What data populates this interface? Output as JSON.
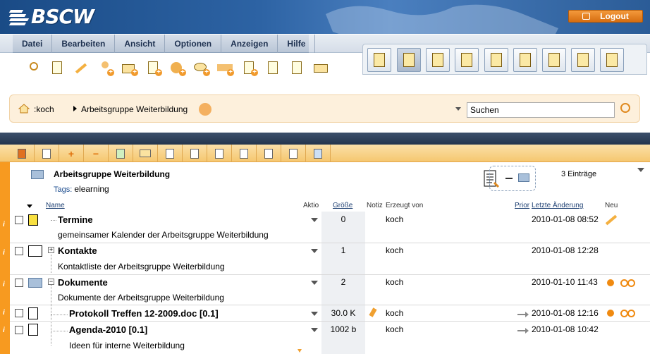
{
  "header": {
    "logo": "BSCW",
    "logout": "Logout"
  },
  "menu": [
    "Datei",
    "Bearbeiten",
    "Ansicht",
    "Optionen",
    "Anzeigen",
    "Hilfe"
  ],
  "toolbar_icons": [
    "search-icon",
    "info-icon",
    "edit-icon",
    "add-member-icon",
    "add-folder-icon",
    "add-document-icon",
    "add-url-icon",
    "add-discussion-icon",
    "add-appointment-icon",
    "add-task-icon",
    "send-icon",
    "copy-icon",
    "card-icon"
  ],
  "nav_buttons": [
    "clipboard-view-icon",
    "home-icon",
    "shared-folders-icon",
    "clipboard-icon",
    "bag-icon",
    "bookmark-icon",
    "calendar-icon",
    "tasks-icon",
    "trash-icon"
  ],
  "breadcrumb": {
    "root": ":koch",
    "current": "Arbeitsgruppe Weiterbildung"
  },
  "search": {
    "placeholder": "Suchen",
    "value": "Suchen"
  },
  "folder": {
    "title": "Arbeitsgruppe Weiterbildung",
    "tags_label": "Tags:",
    "tags_value": "elearning",
    "count": "3 Einträge"
  },
  "columns": {
    "name": "Name",
    "aktio": "Aktio",
    "groesse": "Größe",
    "notiz": "Notiz",
    "erzeugt": "Erzeugt von",
    "prior": "Prior",
    "letzte": "Letzte Änderung",
    "neu": "Neu"
  },
  "rows": [
    {
      "name": "Termine",
      "desc": "gemeinsamer Kalender der Arbeitsgruppe Weiterbildung",
      "size": "0",
      "by": "koch",
      "date": "2010-01-08 08:52"
    },
    {
      "name": "Kontakte",
      "desc": "Kontaktliste der Arbeitsgruppe Weiterbildung",
      "size": "1",
      "by": "koch",
      "date": "2010-01-08 12:28"
    },
    {
      "name": "Dokumente",
      "desc": "Dokumente der Arbeitsgruppe Weiterbildung",
      "size": "2",
      "by": "koch",
      "date": "2010-01-10 11:43"
    },
    {
      "name": "Protokoll Treffen 12-2009.doc [0.1]",
      "desc": "",
      "size": "30.0 K",
      "by": "koch",
      "date": "2010-01-08 12:16"
    },
    {
      "name": "Agenda-2010 [0.1]",
      "desc": "Ideen für interne Weiterbildung",
      "size": "1002 b",
      "by": "koch",
      "date": "2010-01-08 10:42"
    }
  ],
  "colors": {
    "accent": "#f79a20",
    "header": "#2d63a4",
    "crumb_bg": "#fdf0dc"
  }
}
